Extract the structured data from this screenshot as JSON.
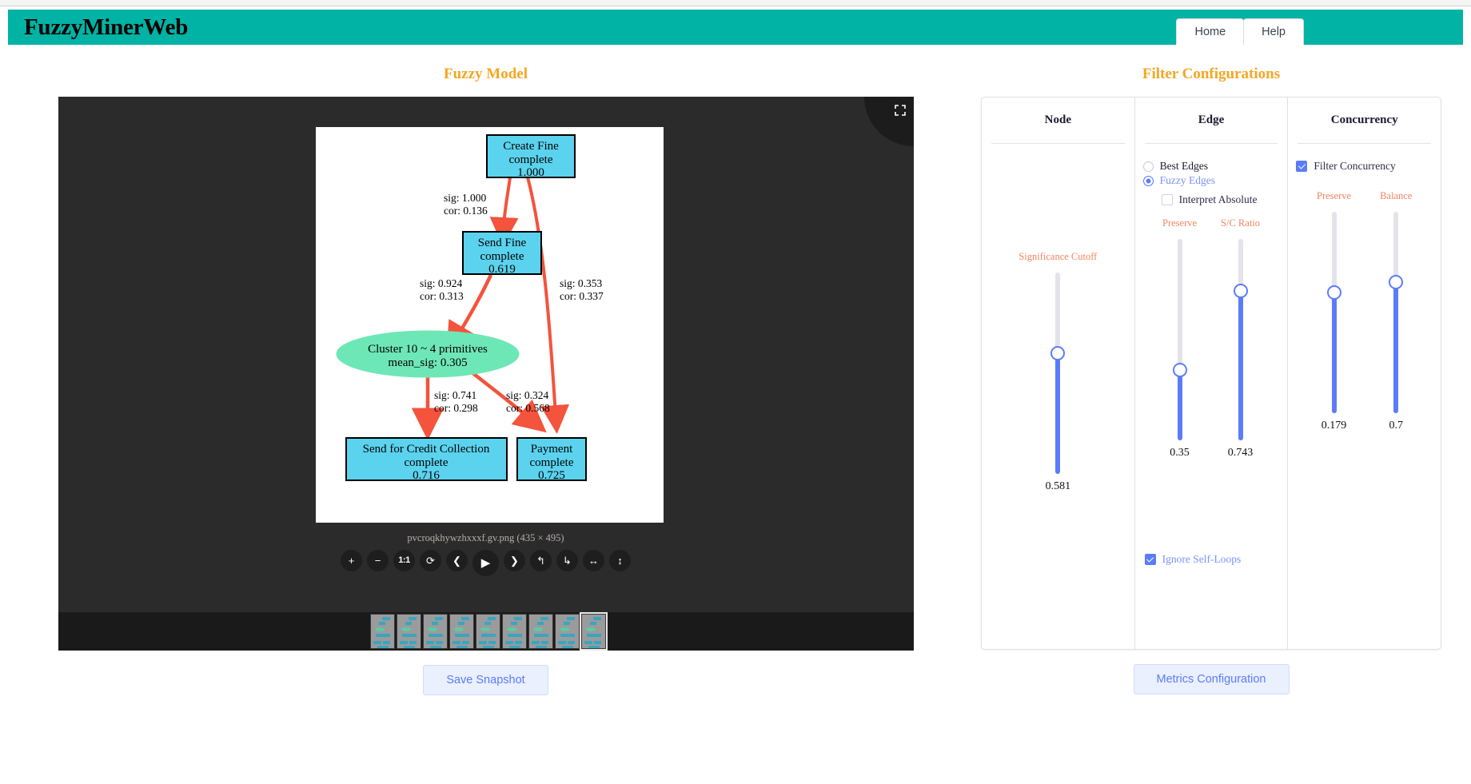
{
  "header": {
    "brand": "FuzzyMinerWeb",
    "tabs": [
      {
        "label": "Home"
      },
      {
        "label": "Help"
      }
    ]
  },
  "left": {
    "title": "Fuzzy Model",
    "viewer": {
      "expand_icon": "fullscreen-icon",
      "caption": "pvcroqkhywzhxxxf.gv.png (435 × 495)",
      "toolbar": [
        {
          "name": "zoom-in-button",
          "glyph": "+"
        },
        {
          "name": "zoom-out-button",
          "glyph": "−"
        },
        {
          "name": "actual-size-button",
          "glyph": "1:1"
        },
        {
          "name": "reset-rotate-button",
          "glyph": "⟳"
        },
        {
          "name": "previous-button",
          "glyph": "❮"
        },
        {
          "name": "play-button",
          "glyph": "▶"
        },
        {
          "name": "next-button",
          "glyph": "❯"
        },
        {
          "name": "rotate-left-button",
          "glyph": "↰"
        },
        {
          "name": "rotate-right-button",
          "glyph": "↳"
        },
        {
          "name": "flip-horizontal-button",
          "glyph": "↔"
        },
        {
          "name": "flip-vertical-button",
          "glyph": "↕"
        }
      ],
      "thumbnail_count": 9,
      "active_thumbnail": 9
    },
    "save_snapshot_label": "Save Snapshot"
  },
  "graph": {
    "nodes": [
      {
        "id": "create-fine",
        "kind": "box",
        "lines": [
          "Create Fine",
          "complete",
          "1.000"
        ]
      },
      {
        "id": "send-fine",
        "kind": "box",
        "lines": [
          "Send Fine",
          "complete",
          "0.619"
        ]
      },
      {
        "id": "cluster-10",
        "kind": "ellipse",
        "lines": [
          "Cluster 10 ~ 4 primitives",
          "mean_sig: 0.305"
        ]
      },
      {
        "id": "send-for-credit-collection",
        "kind": "box",
        "lines": [
          "Send for Credit Collection",
          "complete",
          "0.716"
        ]
      },
      {
        "id": "payment",
        "kind": "box",
        "lines": [
          "Payment",
          "complete",
          "0.725"
        ]
      }
    ],
    "edges": [
      {
        "from": "create-fine",
        "to": "send-fine",
        "sig": "sig: 1.000",
        "cor": "cor: 0.136"
      },
      {
        "from": "create-fine",
        "to": "payment",
        "sig": "sig: 0.353",
        "cor": "cor: 0.337"
      },
      {
        "from": "send-fine",
        "to": "cluster-10",
        "sig": "sig: 0.924",
        "cor": "cor: 0.313"
      },
      {
        "from": "cluster-10",
        "to": "send-for-credit-collection",
        "sig": "sig: 0.741",
        "cor": "cor: 0.298"
      },
      {
        "from": "cluster-10",
        "to": "payment",
        "sig": "sig: 0.324",
        "cor": "cor: 0.568"
      }
    ],
    "colors": {
      "node_fill": "#5BD3EE",
      "cluster_fill": "#6EE7B7",
      "edge": "#F4533C",
      "border": "#000000"
    }
  },
  "right": {
    "title": "Filter Configurations",
    "columns": [
      {
        "title": "Node",
        "sliders": [
          {
            "name": "Significance Cutoff",
            "value": "0.581",
            "fill_ratio": 0.6
          }
        ]
      },
      {
        "title": "Edge",
        "radios": [
          {
            "label": "Best Edges",
            "selected": false
          },
          {
            "label": "Fuzzy Edges",
            "selected": true
          }
        ],
        "checkbox": {
          "label": "Interpret Absolute",
          "checked": false
        },
        "sliders": [
          {
            "name": "Preserve",
            "value": "0.35",
            "fill_ratio": 0.35
          },
          {
            "name": "S/C Ratio",
            "value": "0.743",
            "fill_ratio": 0.743
          }
        ],
        "self_loops": {
          "label": "Ignore Self-Loops",
          "checked": true
        }
      },
      {
        "title": "Concurrency",
        "checkbox": {
          "label": "Filter Concurrency",
          "checked": true
        },
        "sliders": [
          {
            "name": "Preserve",
            "value": "0.179",
            "fill_ratio": 0.6
          },
          {
            "name": "Balance",
            "value": "0.7",
            "fill_ratio": 0.65
          }
        ]
      }
    ],
    "metrics_button_label": "Metrics Configuration"
  },
  "colors": {
    "brand_bar": "#00b3a4",
    "accent_orange": "#f5a623",
    "slider_blue": "#5b7cfa",
    "slider_label_orange": "#f4845f"
  }
}
